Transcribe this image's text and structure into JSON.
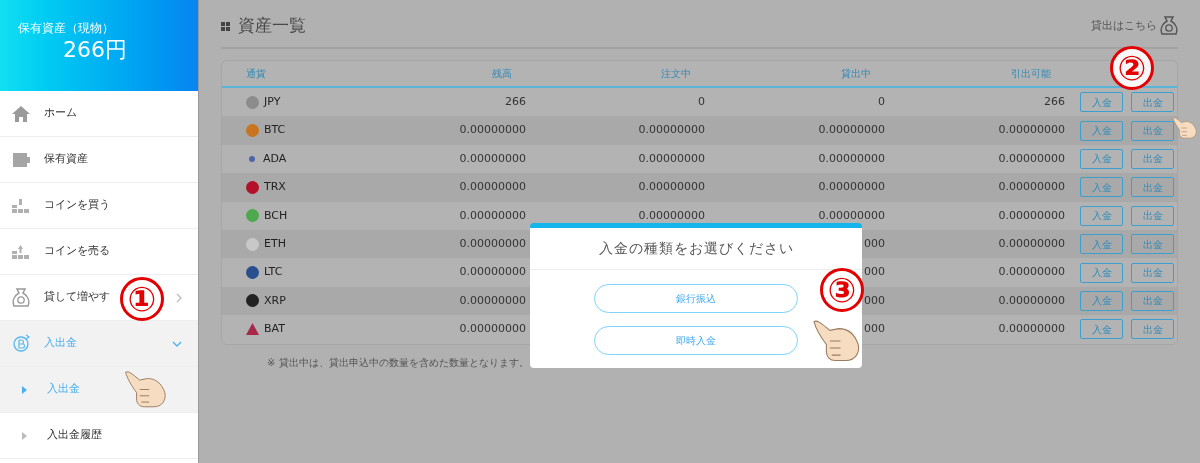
{
  "sidebar": {
    "balance_label": "保有資産（現物）",
    "balance": "266円",
    "items": [
      {
        "label": "ホーム",
        "selected": false
      },
      {
        "label": "保有資産",
        "selected": false
      },
      {
        "label": "コインを買う",
        "selected": false
      },
      {
        "label": "コインを売る",
        "selected": false
      },
      {
        "label": "貸して増やす",
        "selected": false,
        "expanded": false
      },
      {
        "label": "入出金",
        "selected": true,
        "expanded": true,
        "children": [
          {
            "label": "入出金",
            "selected": true
          },
          {
            "label": "入出金履歴",
            "selected": false
          }
        ]
      }
    ]
  },
  "page": {
    "title": "資産一覧",
    "lending_link": "貸出はこちら"
  },
  "table": {
    "columns": [
      "通貨",
      "残高",
      "注文中",
      "貸出中",
      "引出可能"
    ],
    "rows": [
      {
        "currency": "JPY",
        "kind": "coin",
        "color": "#8c8c8c",
        "balance": "266",
        "ordered": "0",
        "lending": "0",
        "withdrawable": "266",
        "deposit": "入金",
        "withdraw": "出金"
      },
      {
        "currency": "BTC",
        "kind": "coin",
        "color": "#c9751f",
        "balance": "0.00000000",
        "ordered": "0.00000000",
        "lending": "0.00000000",
        "withdrawable": "0.00000000",
        "deposit": "入金",
        "withdraw": "出金"
      },
      {
        "currency": "ADA",
        "kind": "dot",
        "color": "#4f63a8",
        "balance": "0.00000000",
        "ordered": "0.00000000",
        "lending": "0.00000000",
        "withdrawable": "0.00000000",
        "deposit": "入金",
        "withdraw": "出金"
      },
      {
        "currency": "TRX",
        "kind": "coin",
        "color": "#b3112a",
        "balance": "0.00000000",
        "ordered": "0.00000000",
        "lending": "0.00000000",
        "withdrawable": "0.00000000",
        "deposit": "入金",
        "withdraw": "出金"
      },
      {
        "currency": "BCH",
        "kind": "coin",
        "color": "#4ea84e",
        "balance": "0.00000000",
        "ordered": "0.00000000",
        "lending": "0.00000000",
        "withdrawable": "0.00000000",
        "deposit": "入金",
        "withdraw": "出金"
      },
      {
        "currency": "ETH",
        "kind": "coin",
        "color": "#c8c8c8",
        "balance": "0.00000000",
        "lending": "000",
        "withdrawable": "0.00000000",
        "deposit": "入金",
        "withdraw": "出金"
      },
      {
        "currency": "LTC",
        "kind": "coin",
        "color": "#2a4f8f",
        "balance": "0.00000000",
        "lending": "000",
        "withdrawable": "0.00000000",
        "deposit": "入金",
        "withdraw": "出金"
      },
      {
        "currency": "XRP",
        "kind": "coin",
        "color": "#222222",
        "balance": "0.00000000",
        "lending": "000",
        "withdrawable": "0.00000000",
        "deposit": "入金",
        "withdraw": "出金"
      },
      {
        "currency": "BAT",
        "kind": "triangle",
        "color": "#a8284a",
        "balance": "0.00000000",
        "lending": "000",
        "withdrawable": "0.00000000",
        "deposit": "入金",
        "withdraw": "出金"
      }
    ],
    "note": "※ 貸出中は、貸出申込中の数量を含めた数量となります。"
  },
  "dialog": {
    "title": "入金の種類をお選びください",
    "options": [
      "銀行振込",
      "即時入金"
    ]
  },
  "callouts": [
    {
      "number": "①"
    },
    {
      "number": "②"
    },
    {
      "number": "③"
    }
  ]
}
